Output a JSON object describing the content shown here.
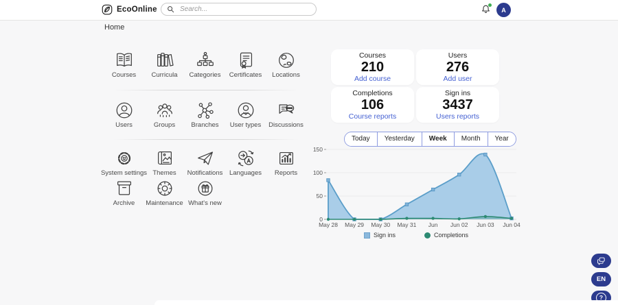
{
  "header": {
    "brand": "EcoOnline",
    "search_placeholder": "Search...",
    "avatar_initial": "A"
  },
  "breadcrumb": {
    "home": "Home"
  },
  "grid": {
    "items": [
      {
        "label": "Courses"
      },
      {
        "label": "Curricula"
      },
      {
        "label": "Categories"
      },
      {
        "label": "Certificates"
      },
      {
        "label": "Locations"
      },
      {
        "label": "Users"
      },
      {
        "label": "Groups"
      },
      {
        "label": "Branches"
      },
      {
        "label": "User types"
      },
      {
        "label": "Discussions"
      },
      {
        "label": "System settings"
      },
      {
        "label": "Themes"
      },
      {
        "label": "Notifications"
      },
      {
        "label": "Languages"
      },
      {
        "label": "Reports"
      },
      {
        "label": "Archive"
      },
      {
        "label": "Maintenance"
      },
      {
        "label": "What's new"
      }
    ]
  },
  "stats": {
    "cards": [
      {
        "label": "Courses",
        "value": "210",
        "link": "Add course"
      },
      {
        "label": "Users",
        "value": "276",
        "link": "Add user"
      },
      {
        "label": "Completions",
        "value": "106",
        "link": "Course reports"
      },
      {
        "label": "Sign ins",
        "value": "3437",
        "link": "Users reports"
      }
    ]
  },
  "filters": {
    "options": [
      "Today",
      "Yesterday",
      "Week",
      "Month",
      "Year"
    ],
    "selected": "Week"
  },
  "chart_data": {
    "type": "area",
    "x": [
      "May 28",
      "May 29",
      "May 30",
      "May 31",
      "Jun",
      "Jun 02",
      "Jun 03",
      "Jun 04"
    ],
    "series": [
      {
        "name": "Sign ins",
        "values": [
          84,
          0,
          0,
          32,
          64,
          96,
          139,
          2
        ],
        "color": "#5b9ec9",
        "fill": "#a9cde8",
        "marker": "square"
      },
      {
        "name": "Completions",
        "values": [
          0,
          0,
          0,
          2,
          2,
          1,
          6,
          2
        ],
        "color": "#2d8a73",
        "fill": "rgba(45,138,115,0.3)",
        "marker": "circle"
      }
    ],
    "ylim": [
      0,
      150
    ],
    "yticks": [
      0,
      50,
      100,
      150
    ],
    "grid": true,
    "legend_position": "bottom"
  },
  "floating": {
    "language": "EN",
    "help": "?"
  },
  "colors": {
    "accent_navy": "#2c3b8e",
    "link_blue": "#4460d2",
    "chart_blue_fill": "#a9cde8",
    "chart_blue_stroke": "#5b9ec9",
    "chart_green": "#2d8a73",
    "notification_dot": "#3fae52"
  }
}
